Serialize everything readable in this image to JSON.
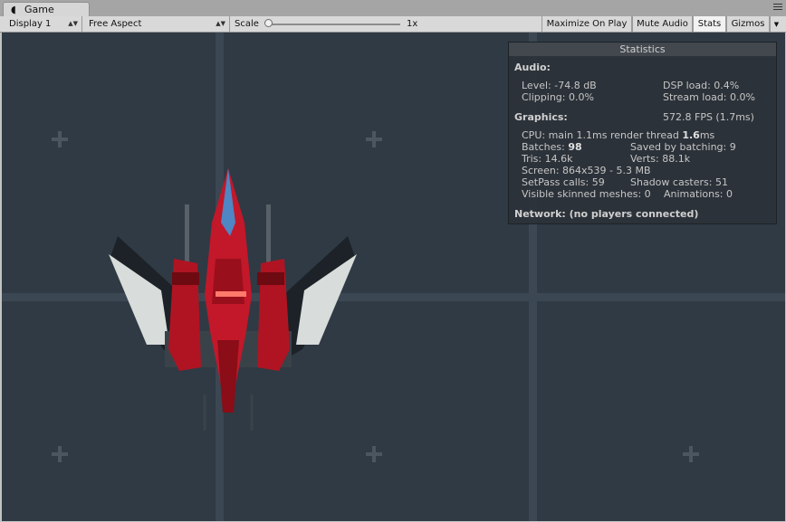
{
  "tab": {
    "icon": "pacman-icon",
    "title": "Game"
  },
  "toolbar": {
    "display": "Display 1",
    "aspect": "Free Aspect",
    "scale_label": "Scale",
    "scale_value": "1x",
    "maximize_on_play": "Maximize On Play",
    "mute_audio": "Mute Audio",
    "stats": "Stats",
    "gizmos": "Gizmos"
  },
  "stats": {
    "title": "Statistics",
    "audio_header": "Audio:",
    "level": "Level: -74.8 dB",
    "clipping": "Clipping: 0.0%",
    "dsp_load": "DSP load: 0.4%",
    "stream_load": "Stream load: 0.0%",
    "graphics_header": "Graphics:",
    "fps": "572.8 FPS (1.7ms)",
    "cpu_prefix": "CPU: main 1.1ms  render thread ",
    "cpu_render": "1.6",
    "cpu_suffix": "ms",
    "batches_prefix": "Batches: ",
    "batches": "98",
    "saved_by_batching": "Saved by batching: 9",
    "tris": "Tris: 14.6k",
    "verts": "Verts: 88.1k",
    "screen": "Screen: 864x539 - 5.3 MB",
    "setpass": "SetPass calls: 59",
    "shadow_casters": "Shadow casters: 51",
    "visible_skinned": "Visible skinned meshes: 0",
    "animations": "Animations: 0",
    "network": "Network: (no players connected)"
  },
  "colors": {
    "background": "#2f3a44",
    "grid_line": "#3d4954",
    "ship_red": "#b01422",
    "ship_blue": "#4f86c4"
  }
}
